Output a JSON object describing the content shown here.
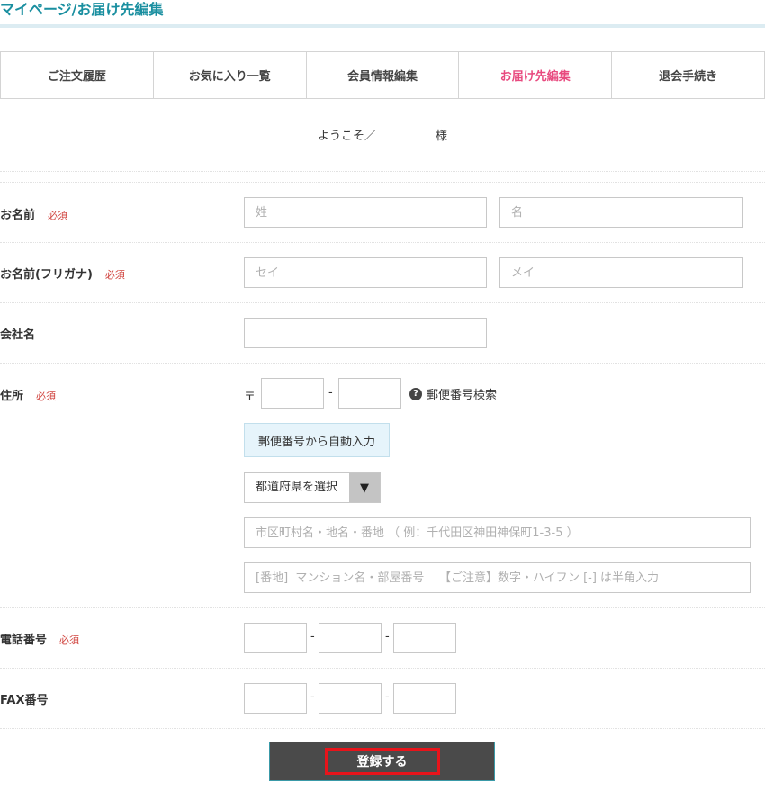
{
  "header": {
    "title": "マイページ/お届け先編集"
  },
  "tabs": [
    {
      "label": "ご注文履歴",
      "active": false
    },
    {
      "label": "お気に入り一覧",
      "active": false
    },
    {
      "label": "会員情報編集",
      "active": false
    },
    {
      "label": "お届け先編集",
      "active": true
    },
    {
      "label": "退会手続き",
      "active": false
    }
  ],
  "welcome": {
    "prefix": "ようこそ／",
    "suffix": "様"
  },
  "required_label": "必須",
  "form": {
    "name": {
      "label": "お名前",
      "last_placeholder": "姓",
      "first_placeholder": "名"
    },
    "kana": {
      "label": "お名前(フリガナ)",
      "last_placeholder": "セイ",
      "first_placeholder": "メイ"
    },
    "company": {
      "label": "会社名"
    },
    "address": {
      "label": "住所",
      "zip_mark": "〒",
      "zip_dash": "-",
      "zip_search_label": "郵便番号検索",
      "auto_fill_label": "郵便番号から自動入力",
      "prefecture_selected": "都道府県を選択",
      "city_placeholder": "市区町村名・地名・番地 （ 例：千代田区神田神保町1-3-5 ）",
      "building_placeholder": "[番地]  マンション名・部屋番号    【ご注意】数字・ハイフン [-] は半角入力"
    },
    "phone": {
      "label": "電話番号",
      "dash": "-"
    },
    "fax": {
      "label": "FAX番号",
      "dash": "-"
    }
  },
  "submit": {
    "label": "登録する"
  },
  "colors": {
    "accent": "#1a8fa0",
    "active_tab": "#e84a7f",
    "required": "#d0433e",
    "submit_bg": "#4a4a4a",
    "highlight": "#e8141b"
  }
}
